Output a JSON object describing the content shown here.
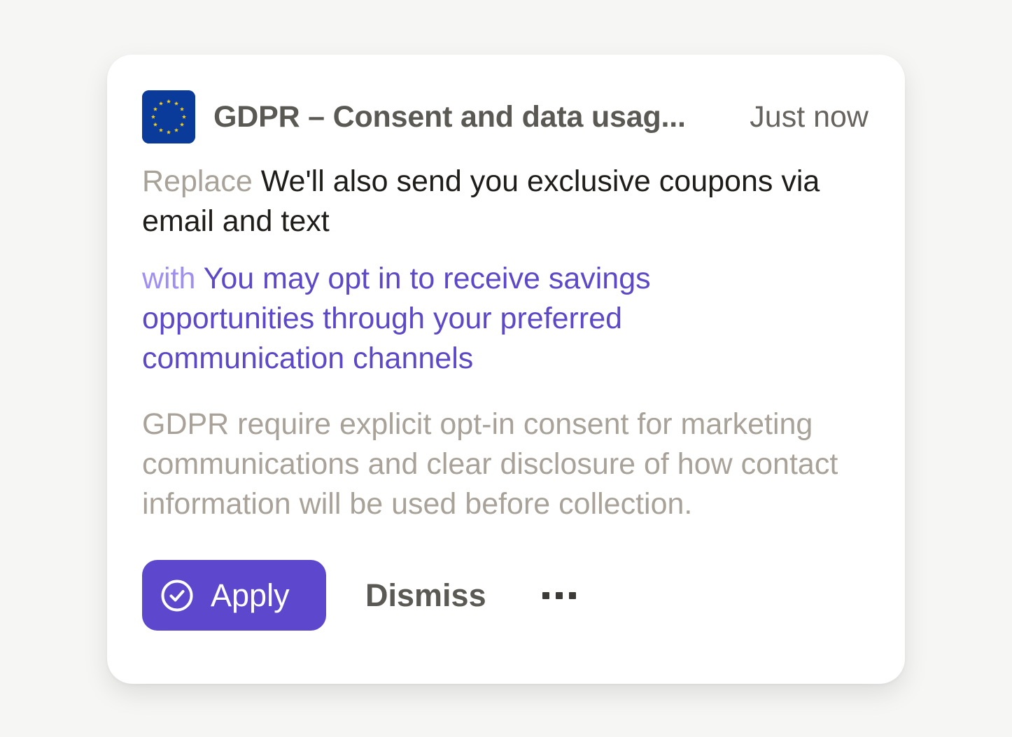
{
  "notification": {
    "title": "GDPR – Consent and data usag...",
    "timestamp": "Just now",
    "icon": "eu-flag-icon",
    "replace_prefix": "Replace",
    "replace_text": "We'll also send you exclusive coupons via email and text",
    "with_prefix": "with",
    "with_text": "You may opt in to receive savings opportunities through your preferred communication channels",
    "explanation": "GDPR require explicit opt-in consent for marketing communications and clear disclosure of how contact information will be used before collection."
  },
  "actions": {
    "apply_label": "Apply",
    "dismiss_label": "Dismiss",
    "more_icon": "more-horizontal-icon"
  },
  "colors": {
    "accent": "#5c47cd",
    "suggestion_text": "#5d49c8",
    "muted_text": "#a8a299",
    "flag_blue": "#0a3a9a",
    "flag_star": "#f7d117"
  }
}
